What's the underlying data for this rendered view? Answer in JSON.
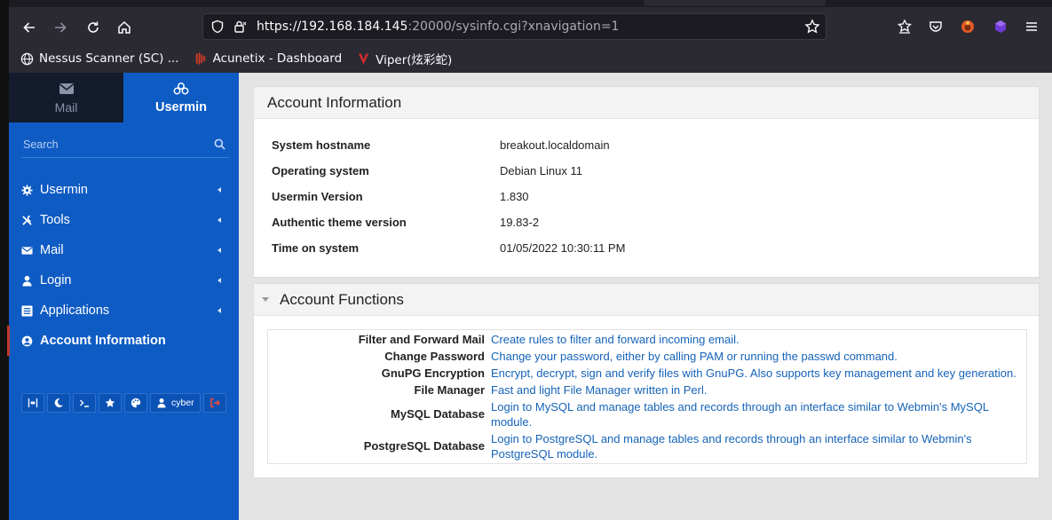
{
  "browser": {
    "url_host": "https://192.168.184.145",
    "url_rest": ":20000/sysinfo.cgi?xnavigation=1",
    "bookmarks": [
      {
        "label": "Nessus Scanner (SC) ..."
      },
      {
        "label": "Acunetix - Dashboard"
      },
      {
        "label": "Viper(炫彩蛇)"
      }
    ]
  },
  "sidebar": {
    "tabs": [
      {
        "label": "Mail"
      },
      {
        "label": "Usermin"
      }
    ],
    "search_placeholder": "Search",
    "items": [
      {
        "label": "Usermin"
      },
      {
        "label": "Tools"
      },
      {
        "label": "Mail"
      },
      {
        "label": "Login"
      },
      {
        "label": "Applications"
      },
      {
        "label": "Account Information"
      }
    ],
    "user_label": "cyber"
  },
  "account_info": {
    "title": "Account Information",
    "rows": [
      {
        "key": "System hostname",
        "value": "breakout.localdomain"
      },
      {
        "key": "Operating system",
        "value": "Debian Linux 11"
      },
      {
        "key": "Usermin Version",
        "value": "1.830"
      },
      {
        "key": "Authentic theme version",
        "value": "19.83-2"
      },
      {
        "key": "Time on system",
        "value": "01/05/2022 10:30:11 PM"
      }
    ]
  },
  "account_functions": {
    "title": "Account Functions",
    "rows": [
      {
        "key": "Filter and Forward Mail",
        "value": "Create rules to filter and forward incoming email."
      },
      {
        "key": "Change Password",
        "value": "Change your password, either by calling PAM or running the passwd command."
      },
      {
        "key": "GnuPG Encryption",
        "value": "Encrypt, decrypt, sign and verify files with GnuPG. Also supports key management and key generation."
      },
      {
        "key": "File Manager",
        "value": "Fast and light File Manager written in Perl."
      },
      {
        "key": "MySQL Database",
        "value": "Login to MySQL and manage tables and records through an interface similar to Webmin's MySQL module."
      },
      {
        "key": "PostgreSQL Database",
        "value": "Login to PostgreSQL and manage tables and records through an interface similar to Webmin's PostgreSQL module."
      }
    ]
  },
  "colors": {
    "sidebar_bg": "#0e5bc4",
    "link": "#1563b8",
    "active_marker": "#c0392b"
  }
}
